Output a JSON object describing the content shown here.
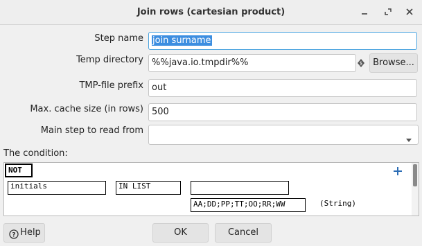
{
  "window": {
    "title": "Join rows (cartesian product)"
  },
  "form": {
    "step_name_label": "Step name",
    "step_name_value": "join surname",
    "temp_dir_label": "Temp directory",
    "temp_dir_value": "%%java.io.tmpdir%%",
    "browse_label": "Browse...",
    "tmp_prefix_label": "TMP-file prefix",
    "tmp_prefix_value": "out",
    "cache_size_label": "Max. cache size (in rows)",
    "cache_size_value": "500",
    "main_step_label": "Main step to read from",
    "main_step_value": ""
  },
  "condition": {
    "label": "The condition:",
    "negate": "NOT",
    "left_field": "initials",
    "function": "IN LIST",
    "right_field": "",
    "value": "AA;DD;PP;TT;OO;RR;WW",
    "value_type": "(String)"
  },
  "footer": {
    "help_label": "Help",
    "ok_label": "OK",
    "cancel_label": "Cancel"
  },
  "icons": {
    "minimize": "minimize-icon",
    "maximize": "maximize-icon",
    "close": "close-icon",
    "variable": "variable-icon",
    "dropdown": "chevron-down-icon",
    "add": "plus-icon",
    "help": "help-icon"
  }
}
